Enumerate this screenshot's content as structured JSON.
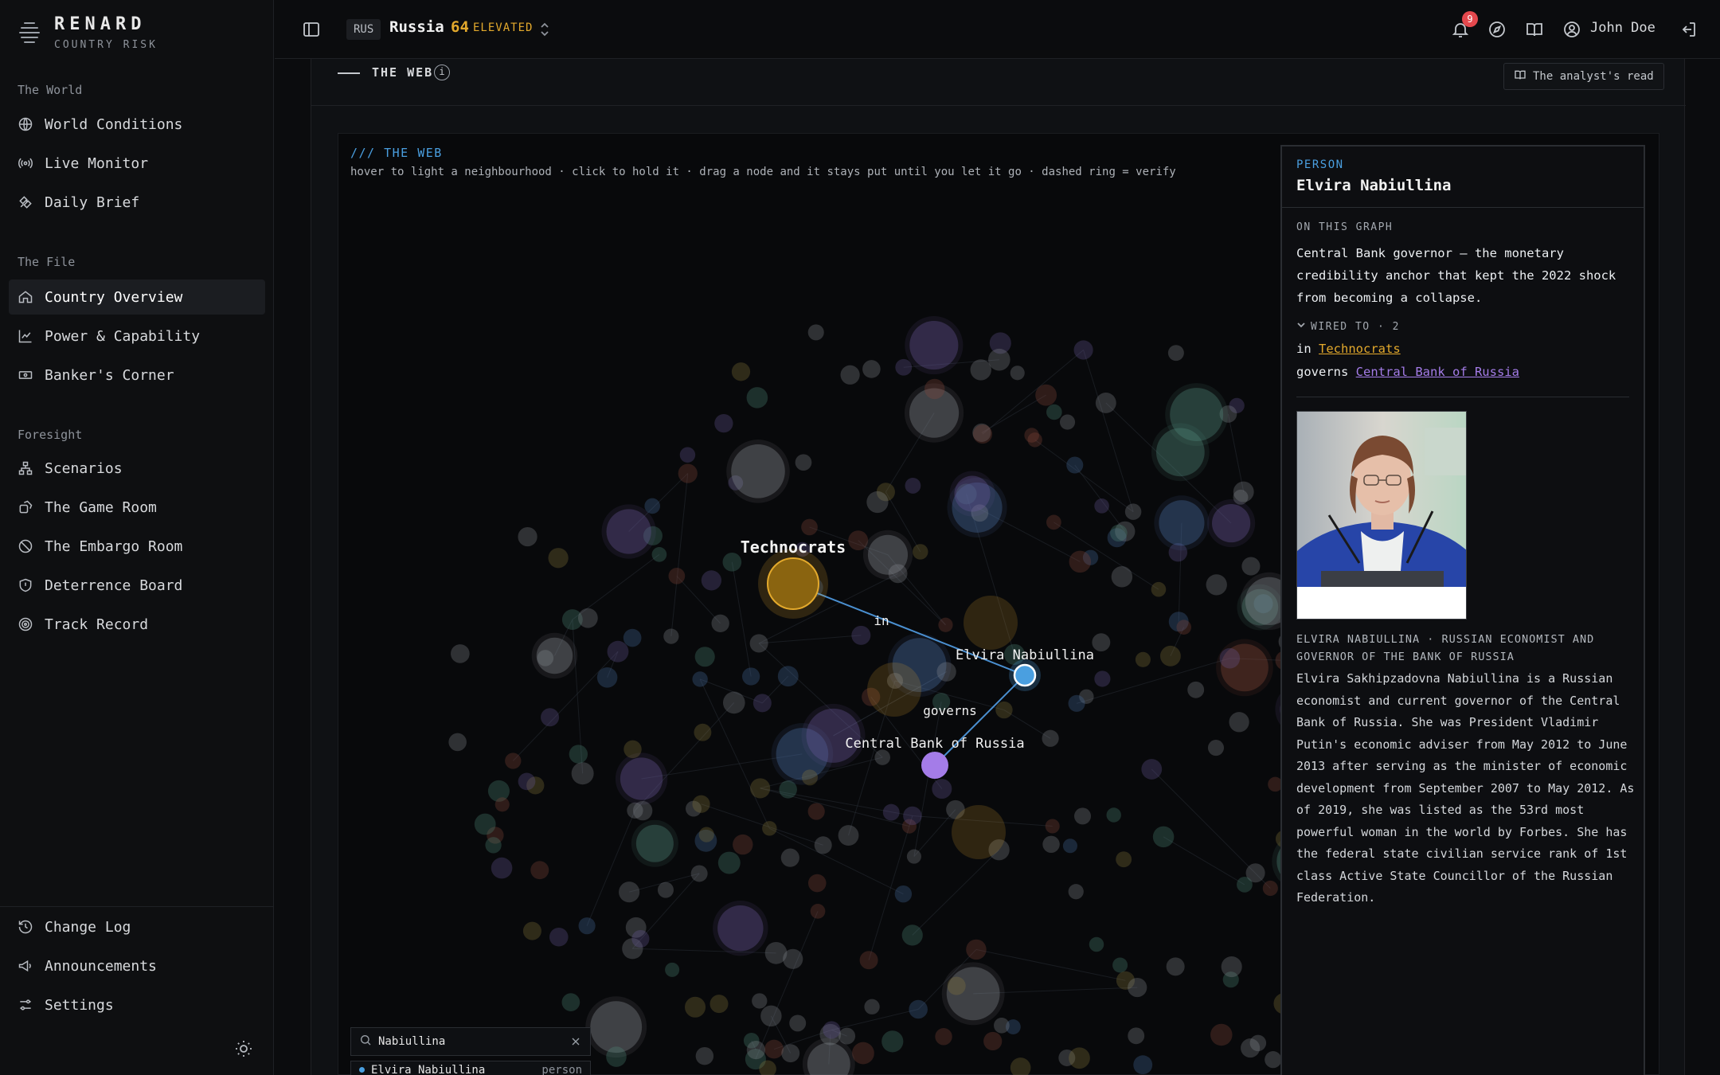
{
  "brand": {
    "name": "RENARD",
    "subtitle": "COUNTRY RISK"
  },
  "sidebar": {
    "sections": [
      {
        "title": "The World",
        "items": [
          {
            "label": "World Conditions",
            "icon": "globe-icon"
          },
          {
            "label": "Live Monitor",
            "icon": "broadcast-icon"
          },
          {
            "label": "Daily Brief",
            "icon": "satellite-icon"
          }
        ]
      },
      {
        "title": "The File",
        "items": [
          {
            "label": "Country Overview",
            "icon": "home-icon",
            "active": true
          },
          {
            "label": "Power & Capability",
            "icon": "line-chart-icon"
          },
          {
            "label": "Banker's Corner",
            "icon": "banknote-icon"
          }
        ]
      },
      {
        "title": "Foresight",
        "items": [
          {
            "label": "Scenarios",
            "icon": "network-icon"
          },
          {
            "label": "The Game Room",
            "icon": "dice-icon"
          },
          {
            "label": "The Embargo Room",
            "icon": "ban-icon"
          },
          {
            "label": "Deterrence Board",
            "icon": "shield-icon"
          },
          {
            "label": "Track Record",
            "icon": "target-icon"
          }
        ]
      }
    ],
    "footer_items": [
      {
        "label": "Change Log",
        "icon": "history-icon"
      },
      {
        "label": "Announcements",
        "icon": "megaphone-icon"
      },
      {
        "label": "Settings",
        "icon": "sliders-icon"
      }
    ]
  },
  "topbar": {
    "country_code": "RUS",
    "country_name": "Russia",
    "risk_score": "64",
    "risk_label": "ELEVATED",
    "notification_count": "9",
    "user_name": "John Doe",
    "risk_color": "#e3a92c"
  },
  "panel": {
    "title": "THE WEB",
    "analyst_button": "The analyst's read"
  },
  "graph": {
    "kicker": "/// THE WEB",
    "hint": "hover to light a neighbourhood · click to hold it · drag a node and it stays put until you let it go · dashed ring = verify",
    "labels": {
      "technocrats": "Technocrats",
      "nabiullina": "Elvira Nabiullina",
      "cbr": "Central Bank of Russia",
      "edge_in": "in",
      "edge_governs": "governs"
    },
    "colors": {
      "person": "#4a9fe0",
      "group": "#e3a92c",
      "institution": "#a47ce8"
    }
  },
  "search": {
    "value": "Nabiullina",
    "result_name": "Elvira Nabiullina",
    "result_type": "person"
  },
  "detail": {
    "kind": "PERSON",
    "name": "Elvira Nabiullina",
    "section_title": "ON THIS GRAPH",
    "summary": "Central Bank governor — the monetary credibility anchor that kept the 2022 shock from becoming a collapse.",
    "wired_to": "WIRED TO · 2",
    "relations": [
      {
        "verb": "in",
        "target": "Technocrats"
      },
      {
        "verb": "governs",
        "target": "Central Bank of Russia"
      }
    ],
    "caption": "ELVIRA NABIULLINA · RUSSIAN ECONOMIST AND GOVERNOR OF THE BANK OF RUSSIA",
    "bio": "Elvira Sakhipzadovna Nabiullina is a Russian economist and current governor of the Central Bank of Russia. She was President Vladimir Putin's economic adviser from May 2012 to June 2013 after serving as the minister of economic development from September 2007 to May 2012. As of 2019, she was listed as the 53rd most powerful woman in the world by Forbes. She has the federal state civilian service rank of 1st class Active State Councillor of the Russian Federation."
  }
}
